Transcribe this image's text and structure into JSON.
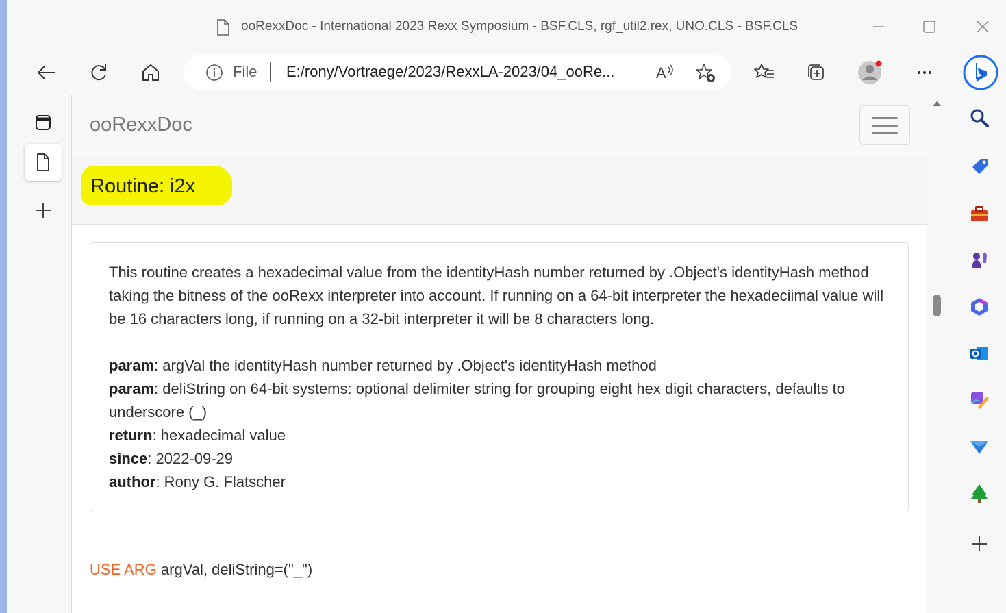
{
  "window": {
    "title": "ooRexxDoc - International 2023 Rexx Symposium - BSF.CLS, rgf_util2.rex, UNO.CLS - BSF.CLS"
  },
  "addressbar": {
    "prefix": "File",
    "url": "E:/rony/Vortraege/2023/RexxLA-2023/04_ooRe..."
  },
  "page": {
    "brand": "ooRexxDoc",
    "heading": "Routine: i2x",
    "description": "This routine creates a hexadecimal value from the identityHash number returned by .Object's identityHash method taking the bitness of the ooRexx interpreter into account. If running on a 64-bit interpreter the hexadeciimal value will be 16 characters long, if running on a 32-bit interpreter it will be 8 characters long.",
    "tags": [
      {
        "name": "param",
        "text": ": argVal the identityHash number returned by .Object's identityHash method"
      },
      {
        "name": "param",
        "text": ": deliString on 64-bit systems: optional delimiter string for grouping eight hex digit characters, defaults to underscore (_)"
      },
      {
        "name": "return",
        "text": ": hexadecimal value"
      },
      {
        "name": "since",
        "text": ": 2022-09-29"
      },
      {
        "name": "author",
        "text": ": Rony G. Flatscher"
      }
    ],
    "code_keyword": "USE ARG",
    "code_rest": " argVal, deliString=(\"_\")"
  },
  "colors": {
    "highlight": "#f4f400",
    "keyword": "#f26322",
    "accent": "#9bb6e6"
  }
}
